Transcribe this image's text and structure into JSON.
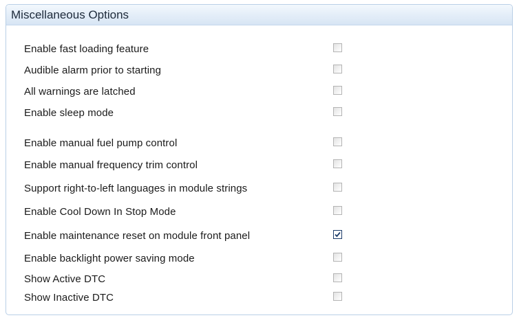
{
  "panel": {
    "title": "Miscellaneous Options"
  },
  "options": [
    {
      "label": "Enable fast loading feature",
      "checked": false
    },
    {
      "label": "Audible alarm prior to starting",
      "checked": false
    },
    {
      "label": "All warnings are latched",
      "checked": false
    },
    {
      "label": "Enable sleep mode",
      "checked": false
    },
    {
      "label": "Enable manual fuel pump control",
      "checked": false
    },
    {
      "label": "Enable manual frequency trim control",
      "checked": false
    },
    {
      "label": "Support right-to-left languages in module strings",
      "checked": false
    },
    {
      "label": "Enable Cool Down In Stop Mode",
      "checked": false
    },
    {
      "label": "Enable maintenance reset on module front panel",
      "checked": true
    },
    {
      "label": "Enable backlight power saving mode",
      "checked": false
    },
    {
      "label": "Show Active DTC",
      "checked": false
    },
    {
      "label": "Show Inactive DTC",
      "checked": false
    }
  ],
  "colors": {
    "header_gradient_top": "#f3f8fd",
    "header_gradient_bottom": "#d7e5f4",
    "panel_border": "#b9cfe6",
    "check_mark": "#1c3c6a"
  },
  "icons": {
    "checked": "check-mark-icon"
  }
}
